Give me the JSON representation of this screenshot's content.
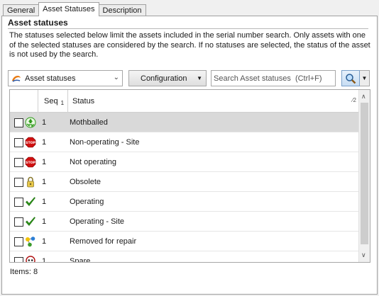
{
  "tabs": [
    {
      "label": "General"
    },
    {
      "label": "Asset Statuses"
    },
    {
      "label": "Description"
    }
  ],
  "group": {
    "title": "Asset statuses",
    "description": "The statuses selected below limit the assets included in the serial number search.  Only assets with one of the selected statuses are considered by the search.   If no statuses are selected, the status of the asset is not used by the search."
  },
  "toolbar": {
    "combo_value": "Asset statuses",
    "configuration_label": "Configuration",
    "search_placeholder": "Search Asset statuses  (Ctrl+F)"
  },
  "grid": {
    "columns": {
      "seq": "Seq",
      "seq_sort": "1",
      "status": "Status",
      "status_sort": "2"
    },
    "rows": [
      {
        "seq": "1",
        "status": "Mothballed",
        "icon": "recycle-icon",
        "selected": true
      },
      {
        "seq": "1",
        "status": "Non-operating - Site",
        "icon": "stop-sign-icon"
      },
      {
        "seq": "1",
        "status": "Not operating",
        "icon": "stop-sign-icon"
      },
      {
        "seq": "1",
        "status": "Obsolete",
        "icon": "lock-icon"
      },
      {
        "seq": "1",
        "status": "Operating",
        "icon": "checkmark-icon"
      },
      {
        "seq": "1",
        "status": "Operating - Site",
        "icon": "checkmark-icon"
      },
      {
        "seq": "1",
        "status": "Removed for repair",
        "icon": "molecule-icon"
      },
      {
        "seq": "1",
        "status": "Spare",
        "icon": "skull-icon"
      }
    ]
  },
  "footer": {
    "items_label": "Items: 8"
  },
  "colors": {
    "selected_row": "#d9d9d9",
    "stop_red": "#d01010",
    "check_green": "#2e9a1a"
  }
}
